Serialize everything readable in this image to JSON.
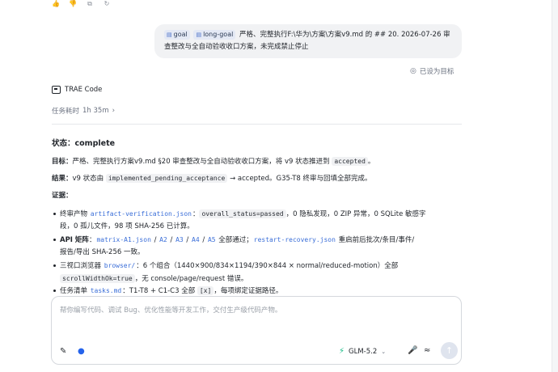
{
  "top_actions": [
    "thumbs-up-icon",
    "thumbs-down-icon",
    "copy-icon",
    "refresh-icon"
  ],
  "user_message": {
    "tags": [
      "goal",
      "long-goal"
    ],
    "text": "严格、完整执行F:\\华为\\方案\\方案v9.md 的 ## 20. 2026-07-26 审查整改与全自动验收收口方案，未完成禁止停止"
  },
  "set_goal_label": "已设为目标",
  "agent": {
    "name": "TRAE Code",
    "elapsed_label": "任务耗时",
    "elapsed_value": "1h 35m"
  },
  "report": {
    "status_label": "状态：",
    "status_value": "complete",
    "goal_label": "目标：",
    "goal_text_1": "严格、完整执行方案v9.md §20 审查整改与全自动验收收口方案，将 v9 状态推进到",
    "goal_code": "accepted",
    "goal_text_2": "。",
    "result_label": "结果：",
    "result_text_1": "v9 状态由",
    "result_code": "implemented_pending_acceptance",
    "result_text_2": "→ accepted。G35-T8 终审与回填全部完成。",
    "evidence_label": "证据：",
    "evidence": {
      "e1_prefix": "终审产物",
      "e1_file": "artifact-verification.json",
      "e1_colon": "：",
      "e1_code": "overall_status=passed",
      "e1_rest": "，0 隐私发现，0 ZIP 异常，0 SQLite 敏感字",
      "e1_line2": "段，0 孤儿文件，98 项 SHA-256 已计算。",
      "e2_label": "API 矩阵",
      "e2_colon": "：",
      "e2_f1": "matrix-A1.json",
      "e2_sep1": " / ",
      "e2_f2": "A2",
      "e2_sep2": " / ",
      "e2_f3": "A3",
      "e2_sep3": " / ",
      "e2_f4": "A4",
      "e2_sep4": " / ",
      "e2_f5": "A5",
      "e2_mid": " 全部通过；",
      "e2_f6": "restart-recovery.json",
      "e2_rest": " 重启前后批次/条目/事件/",
      "e2_line2": "报告/导出 SHA-256 一致。",
      "e3_prefix": "三视口浏览器",
      "e3_file": "browser/",
      "e3_rest": "：6 个组合（1440×900/834×1194/390×844 × normal/reduced-motion）全部",
      "e3_code": "scrollWidthOk=true",
      "e3_rest2": "，无 console/page/request 错误。",
      "e4_prefix": "任务清单",
      "e4_file": "tasks.md",
      "e4_mid": "：T1-T8 + C1-C3 全部",
      "e4_code": "[x]",
      "e4_rest": "，每项绑定证据路径。"
    }
  },
  "input": {
    "placeholder": "帮你编写代码、调试 Bug、优化性能等开发工作，交付生产级代码产物。",
    "model": "GLM-5.2"
  }
}
